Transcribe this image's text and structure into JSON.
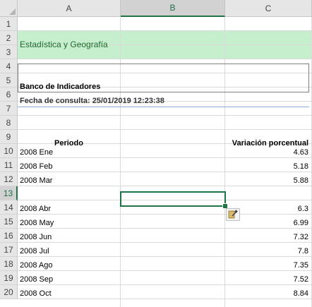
{
  "columns": [
    "A",
    "B",
    "C"
  ],
  "rows": [
    "1",
    "2",
    "3",
    "4",
    "5",
    "6",
    "7",
    "8",
    "9",
    "10",
    "11",
    "12",
    "13",
    "14",
    "15",
    "16",
    "17",
    "18",
    "19",
    "20"
  ],
  "header_block": {
    "institution": "Estadística y Geografía",
    "bank_title": "Banco de Indicadores",
    "query_date": "Fecha de consulta: 25/01/2019 12:23:38"
  },
  "table": {
    "col_period": "Periodo",
    "col_variation": "Variación porcentual",
    "rows": [
      {
        "row": 10,
        "period": "2008 Ene",
        "value": "4.63"
      },
      {
        "row": 11,
        "period": "2008 Feb",
        "value": "5.18"
      },
      {
        "row": 12,
        "period": "2008 Mar",
        "value": "5.88"
      },
      {
        "row": 14,
        "period": "2008 Abr",
        "value": "6.3"
      },
      {
        "row": 15,
        "period": "2008 May",
        "value": "6.99"
      },
      {
        "row": 16,
        "period": "2008 Jun",
        "value": "7.32"
      },
      {
        "row": 17,
        "period": "2008 Jul",
        "value": "7.8"
      },
      {
        "row": 18,
        "period": "2008 Ago",
        "value": "7.35"
      },
      {
        "row": 19,
        "period": "2008 Sep",
        "value": "7.52"
      },
      {
        "row": 20,
        "period": "2008 Oct",
        "value": "8.84"
      }
    ]
  },
  "selection": {
    "column": "B",
    "row": "13"
  },
  "paste_options_icon": "paintbrush-icon",
  "colors": {
    "accent": "#217346",
    "band": "#c6efce",
    "title_text": "#1e6b2c"
  }
}
